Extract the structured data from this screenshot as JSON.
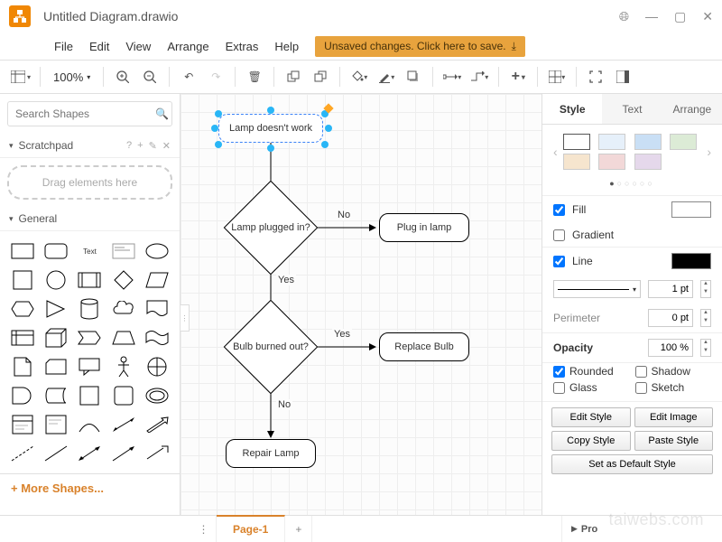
{
  "title": "Untitled Diagram.drawio",
  "menu": {
    "file": "File",
    "edit": "Edit",
    "view": "View",
    "arrange": "Arrange",
    "extras": "Extras",
    "help": "Help"
  },
  "save_banner": "Unsaved changes. Click here to save.",
  "zoom": "100%",
  "search_placeholder": "Search Shapes",
  "scratchpad": {
    "title": "Scratchpad",
    "hint": "Drag elements here"
  },
  "general_header": "General",
  "more_shapes": "More Shapes...",
  "nodes": {
    "start": "Lamp doesn't work",
    "d1": "Lamp plugged in?",
    "a1": "Plug in lamp",
    "d2": "Bulb burned out?",
    "a2": "Replace Bulb",
    "a3": "Repair Lamp"
  },
  "edge_labels": {
    "d1_no": "No",
    "d1_yes": "Yes",
    "d2_yes": "Yes",
    "d2_no": "No"
  },
  "right_tabs": {
    "style": "Style",
    "text": "Text",
    "arrange": "Arrange"
  },
  "swatches": [
    "#ffffff",
    "#e6f0fa",
    "#c9dff5",
    "#dcebd6",
    "#f6e5ce",
    "#f2d8d8",
    "#e5d8eb"
  ],
  "style": {
    "fill": "Fill",
    "fill_color": "#ffffff",
    "gradient": "Gradient",
    "line": "Line",
    "line_color": "#000000",
    "line_width": "1 pt",
    "perimeter": "Perimeter",
    "perimeter_val": "0 pt",
    "opacity": "Opacity",
    "opacity_val": "100 %",
    "rounded": "Rounded",
    "shadow": "Shadow",
    "glass": "Glass",
    "sketch": "Sketch",
    "edit_style": "Edit Style",
    "edit_image": "Edit Image",
    "copy_style": "Copy Style",
    "paste_style": "Paste Style",
    "default_style": "Set as Default Style"
  },
  "page_tab": "Page-1",
  "props_label": "Pro",
  "watermark": "taiwebs.com"
}
